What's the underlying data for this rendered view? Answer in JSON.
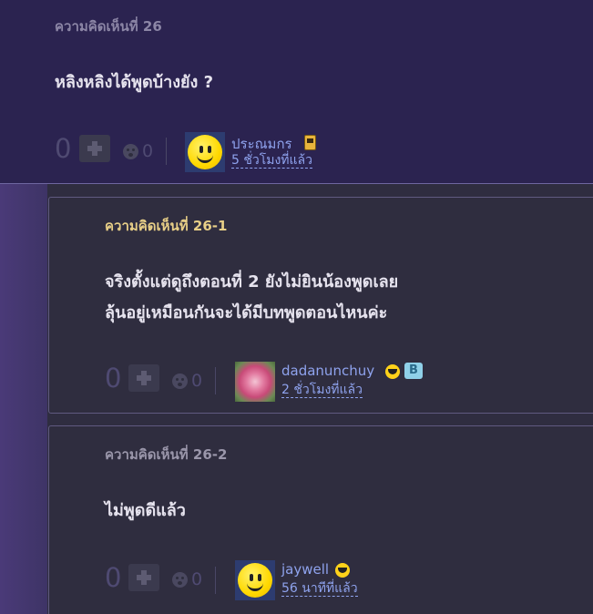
{
  "comments": [
    {
      "header": "ความคิดเห็นที่ 26",
      "lines": [
        "หลิงหลิงได้พูดบ้างยัง ?"
      ],
      "votes": "0",
      "emo_count": "0",
      "username": "ประณมกร",
      "time": "5 ชั่วโมงที่แล้ว",
      "avatar": "smiley-avatar",
      "badges": [
        "phone-icon"
      ]
    },
    {
      "header": "ความคิดเห็นที่ 26-1",
      "lines": [
        "จริงตั้งแต่ดูถึงตอนที่ 2 ยังไม่ยินน้องพูดเลย",
        "ลุ้นอยู่เหมือนกันจะได้มีบทพูดตอนไหนค่ะ"
      ],
      "votes": "0",
      "emo_count": "0",
      "username": "dadanunchuy",
      "time": "2 ชั่วโมงที่แล้ว",
      "avatar": "rose-avatar",
      "badges": [
        "laughing-emoji-icon",
        "b-icon"
      ]
    },
    {
      "header": "ความคิดเห็นที่ 26-2",
      "lines": [
        "ไม่พูดดีแล้ว"
      ],
      "votes": "0",
      "emo_count": "0",
      "username": "jaywell",
      "time": "56 นาทีที่แล้ว",
      "avatar": "smiley-avatar",
      "badges": [
        "laughing-emoji-icon"
      ]
    }
  ],
  "colors": {
    "header_main": "#8c86a6",
    "header_reply1": "#e8cf87",
    "header_reply2": "#9a96aa",
    "link": "#8fa3ee"
  },
  "b_icon_label": "B"
}
